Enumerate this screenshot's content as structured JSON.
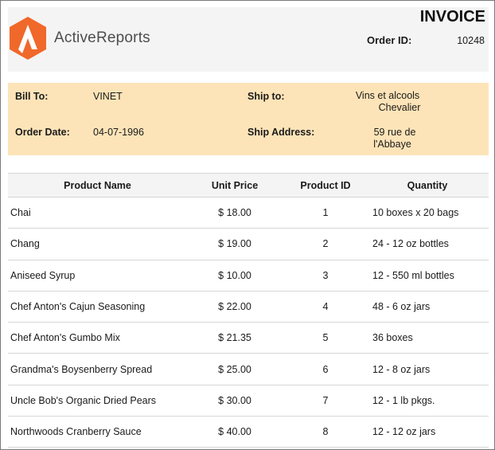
{
  "brand": {
    "name": "ActiveReports",
    "logo_icon": "activereports-logo-icon",
    "logo_color": "#f0682a"
  },
  "header": {
    "title": "INVOICE",
    "order_id_label": "Order ID:",
    "order_id": "10248"
  },
  "billing": {
    "bill_to_label": "Bill To:",
    "bill_to": "VINET",
    "order_date_label": "Order Date:",
    "order_date": "04-07-1996",
    "ship_to_label": "Ship to:",
    "ship_to_line1": "Vins et alcools",
    "ship_to_line2": "Chevalier",
    "ship_address_label": "Ship Address:",
    "ship_address_line1": "59 rue de",
    "ship_address_line2": "l'Abbaye",
    "band_color": "#fde4b8"
  },
  "table": {
    "headers": [
      "Product Name",
      "Unit Price",
      "Product ID",
      "Quantity"
    ],
    "rows": [
      [
        "Chai",
        "$ 18.00",
        "1",
        "10 boxes x 20 bags"
      ],
      [
        "Chang",
        "$ 19.00",
        "2",
        "24 - 12 oz bottles"
      ],
      [
        "Aniseed Syrup",
        "$ 10.00",
        "3",
        "12 - 550 ml bottles"
      ],
      [
        "Chef Anton's Cajun Seasoning",
        "$ 22.00",
        "4",
        "48 - 6 oz jars"
      ],
      [
        "Chef Anton's Gumbo Mix",
        "$ 21.35",
        "5",
        "36 boxes"
      ],
      [
        "Grandma's Boysenberry Spread",
        "$ 25.00",
        "6",
        "12 - 8 oz jars"
      ],
      [
        "Uncle Bob's Organic Dried Pears",
        "$ 30.00",
        "7",
        "12 - 1 lb pkgs."
      ],
      [
        "Northwoods Cranberry Sauce",
        "$ 40.00",
        "8",
        "12 - 12 oz jars"
      ]
    ]
  }
}
